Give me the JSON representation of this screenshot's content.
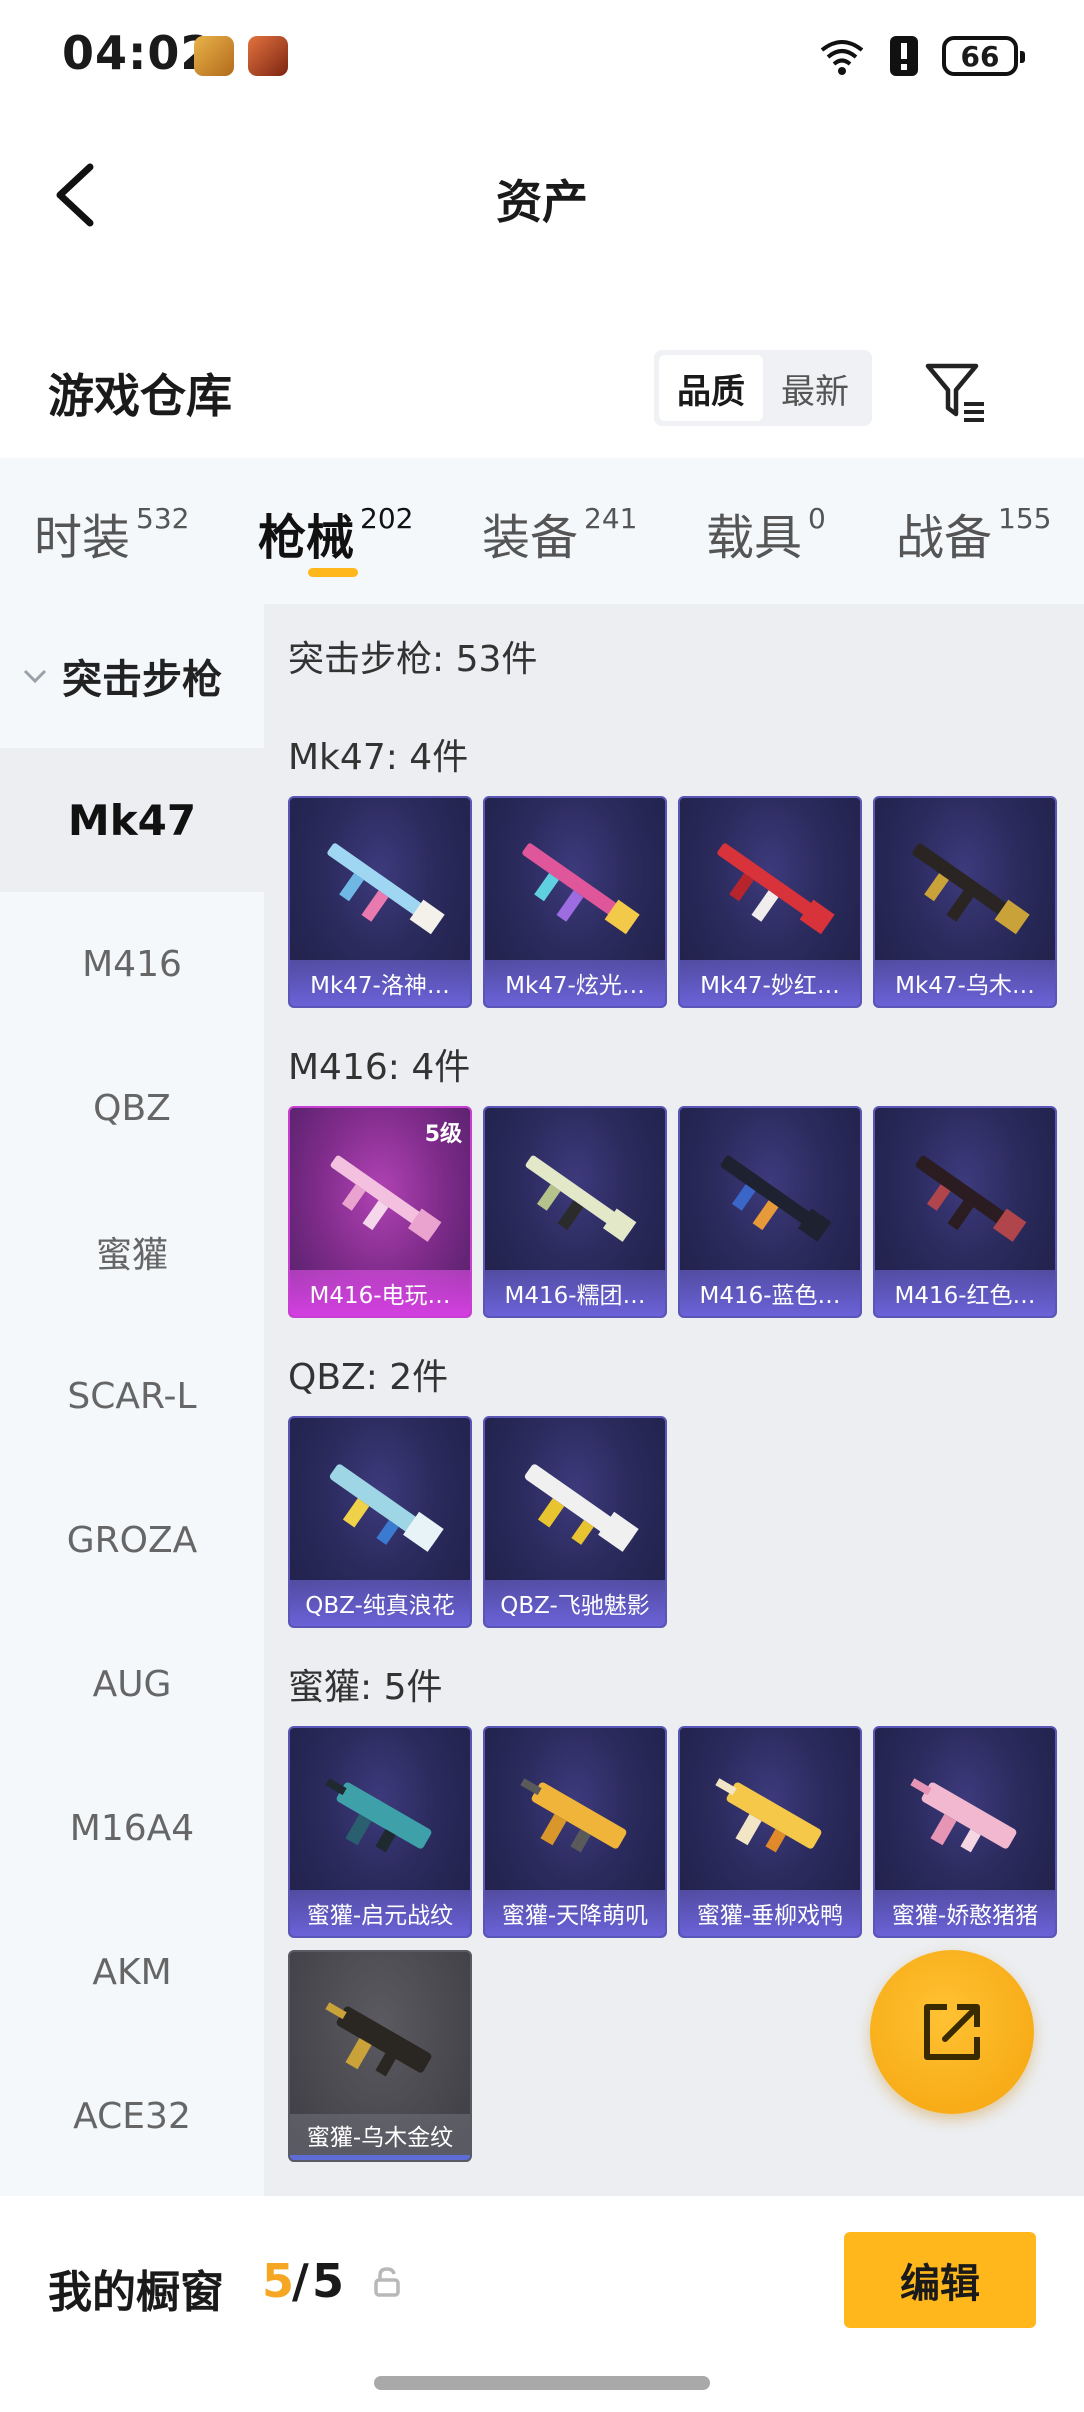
{
  "status_bar": {
    "time": "04:02",
    "battery": "66"
  },
  "title_bar": {
    "title": "资产"
  },
  "warehouse": {
    "title": "游戏仓库",
    "sort_options": [
      "品质",
      "最新"
    ],
    "active_sort": "品质"
  },
  "tabs": [
    {
      "label": "时装",
      "count": "532"
    },
    {
      "label": "枪械",
      "count": "202"
    },
    {
      "label": "装备",
      "count": "241"
    },
    {
      "label": "载具",
      "count": "0"
    },
    {
      "label": "战备",
      "count": "155"
    }
  ],
  "active_tab": "枪械",
  "sidebar": {
    "group": "突击步枪",
    "items": [
      "Mk47",
      "M416",
      "QBZ",
      "蜜獾",
      "SCAR-L",
      "GROZA",
      "AUG",
      "M16A4",
      "AKM",
      "ACE32"
    ],
    "active": "Mk47"
  },
  "content": {
    "total": "突击步枪: 53件",
    "sections": [
      {
        "label": "Mk47: 4件",
        "items": [
          "Mk47-洛神…",
          "Mk47-炫光…",
          "Mk47-妙红…",
          "Mk47-乌木…"
        ]
      },
      {
        "label": "M416: 4件",
        "items": [
          "M416-电玩…",
          "M416-糯团…",
          "M416-蓝色…",
          "M416-红色…"
        ],
        "badge": "5级"
      },
      {
        "label": "QBZ: 2件",
        "items": [
          "QBZ-纯真浪花",
          "QBZ-飞驰魅影"
        ]
      },
      {
        "label": "蜜獾: 5件",
        "items": [
          "蜜獾-启元战纹",
          "蜜獾-天降萌叽",
          "蜜獾-垂柳戏鸭",
          "蜜獾-娇憨猪猪",
          "蜜獾-乌木金纹"
        ]
      }
    ]
  },
  "bottom_bar": {
    "showcase_label": "我的橱窗",
    "used": "5",
    "separator": "/",
    "total": "5",
    "edit_label": "编辑"
  },
  "colors": {
    "accent": "#ffb71b",
    "card_border": "#5a56b8",
    "card_name_bg": "#6b62d8",
    "epic_pink": "#d33fe0"
  }
}
